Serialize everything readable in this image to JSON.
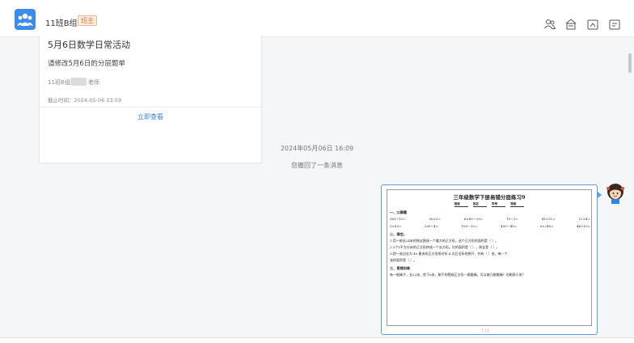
{
  "header": {
    "group_name": "11班B组",
    "role_badge": "班主",
    "icons": [
      "group-members-icon",
      "home-icon",
      "folder-icon",
      "image-icon"
    ]
  },
  "card": {
    "title": "5月6日数学日常活动",
    "subtitle": "请修改5月6日的分层题单",
    "sender_prefix": "11班B组",
    "sender_suffix": "老师",
    "deadline": "截止时间：2024-05-06 23:59",
    "view_button": "立即查看"
  },
  "timestamp": "2024年05月06日 16:09",
  "recall_notice": "您撤回了一条消息",
  "worksheet": {
    "title": "三年级数学下册易错分层练习9",
    "fields": [
      "班级",
      "姓名",
      "序号",
      "等级"
    ],
    "section1": "一、口算题",
    "row1": [
      "561÷12=",
      "50×5=",
      "6×80－20=",
      "15÷3=",
      "41×21=",
      "12×4="
    ],
    "row2": [
      "5×80=",
      "200÷4=",
      "100－32=",
      "400－40=",
      "0×245=",
      "46×10="
    ],
    "section2": "二、填空。",
    "q1": "1.用一根长24米的铁丝围成一个最大的正方形，这个正方形的面积是（        ）。",
    "q2": "2.3个1平方分米的正方形拼成一个长方形，它的面积是（        ），周长是（        ）。",
    "q3": "3.把一张边长为 40 厘米的正方形纸对折 4 次后沿折线剪开，共有（      ）张，每一个",
    "q3b": "张的面积是（      ）。",
    "section3": "三、易错训练",
    "q4": "有一根绳子，长22米，剪下6米，剩下的围成正方形一根跳绳，可以做几根跳绳？还剩多少米？",
    "bottom_mark": "| | |"
  },
  "colors": {
    "accent": "#3b7be6",
    "badge": "#e8722c",
    "bubble_border": "#5c9ee6"
  }
}
